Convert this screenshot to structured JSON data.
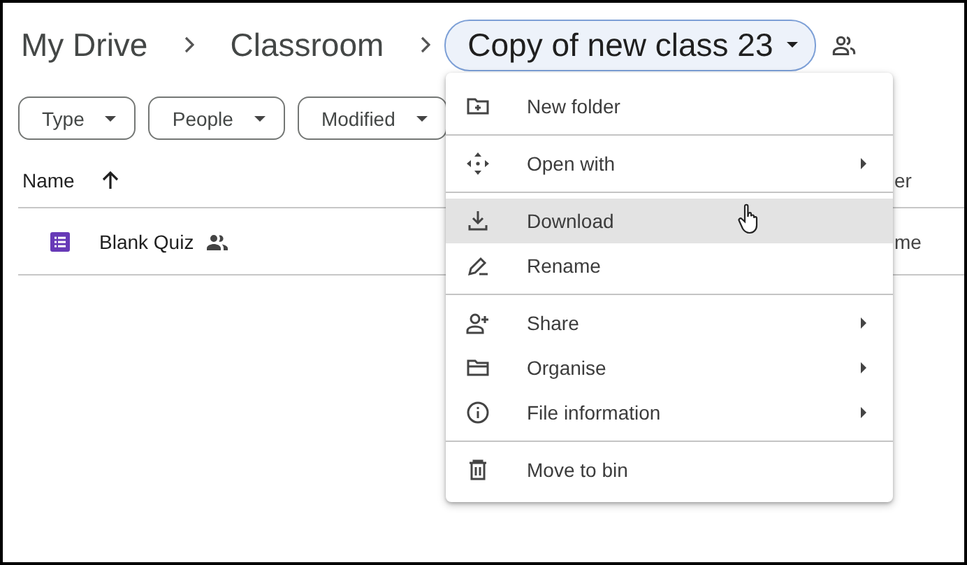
{
  "breadcrumb": {
    "items": [
      "My Drive",
      "Classroom"
    ],
    "current": {
      "label": "Copy of new class 23",
      "shared": true
    }
  },
  "filters": [
    "Type",
    "People",
    "Modified"
  ],
  "file_list": {
    "columns": [
      {
        "label": "Name",
        "sorted": true
      },
      {
        "label": "er"
      }
    ],
    "rows": [
      {
        "name": "Blank Quiz",
        "shared": true,
        "column_2": "me"
      }
    ]
  },
  "context_menu": {
    "sections": [
      [
        {
          "label": "New folder",
          "submenu": false,
          "selected": false
        }
      ],
      [
        {
          "label": "Open with",
          "submenu": true,
          "selected": false
        }
      ],
      [
        {
          "label": "Download",
          "submenu": false,
          "selected": true
        },
        {
          "label": "Rename",
          "submenu": false,
          "selected": false
        }
      ],
      [
        {
          "label": "Share",
          "submenu": true,
          "selected": false
        },
        {
          "label": "Organise",
          "submenu": true,
          "selected": false
        },
        {
          "label": "File information",
          "submenu": true,
          "selected": false
        }
      ],
      [
        {
          "label": "Move to bin",
          "submenu": false,
          "selected": false
        }
      ]
    ]
  }
}
